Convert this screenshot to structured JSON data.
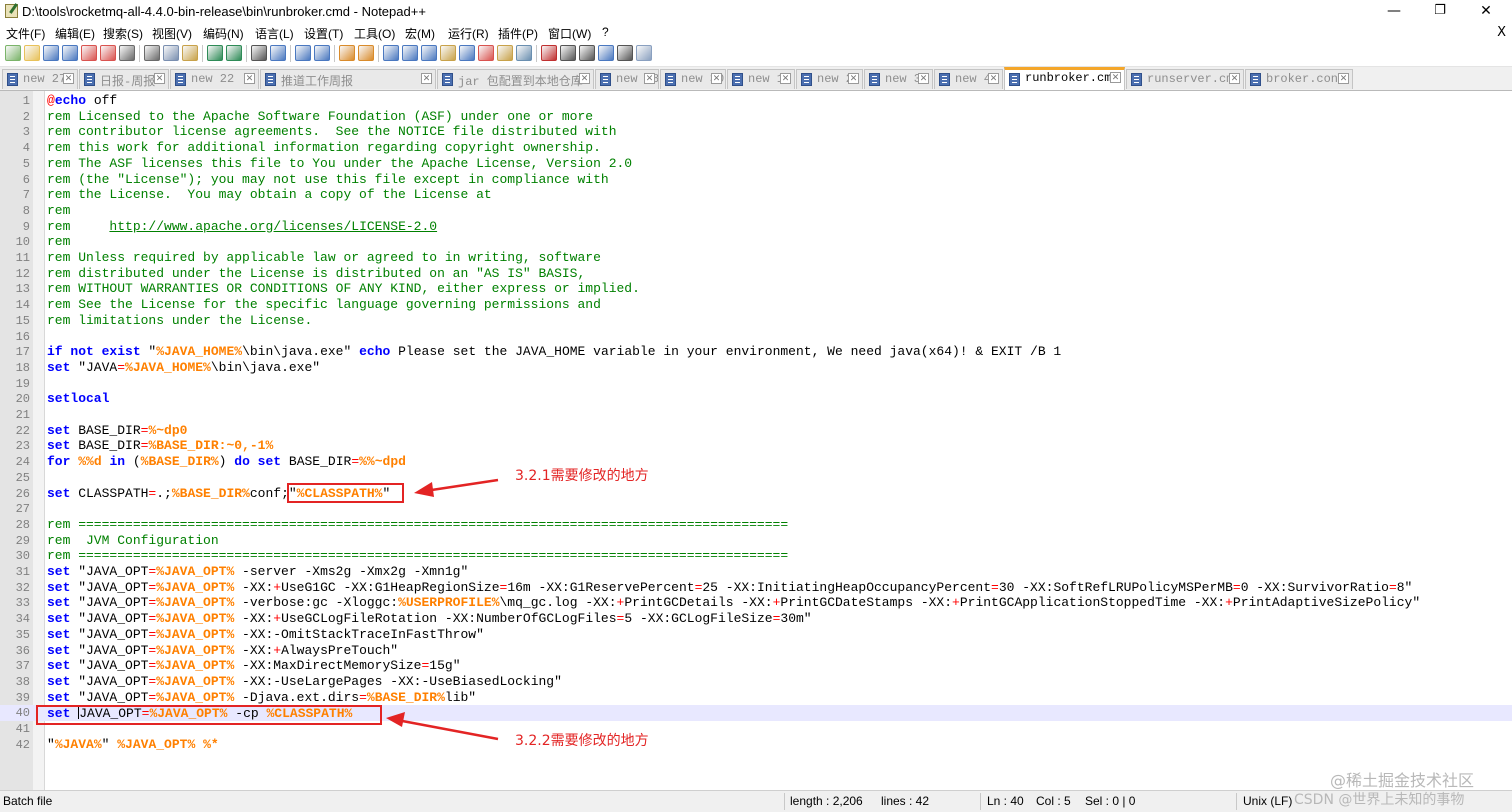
{
  "window": {
    "title": "D:\\tools\\rocketmq-all-4.4.0-bin-release\\bin\\runbroker.cmd - Notepad++",
    "minimize": "—",
    "maximize": "❐",
    "close": "✕"
  },
  "menu": {
    "items": [
      "文件(F)",
      "编辑(E)",
      "搜索(S)",
      "视图(V)",
      "编码(N)",
      "语言(L)",
      "设置(T)",
      "工具(O)",
      "宏(M)",
      "运行(R)",
      "插件(P)",
      "窗口(W)",
      "?"
    ],
    "close": "X"
  },
  "toolbar": {
    "buttons": [
      "new-file",
      "open-file",
      "save",
      "save-all",
      "close",
      "close-all",
      "print",
      "cut",
      "copy",
      "paste",
      "undo",
      "redo",
      "find",
      "replace",
      "zoom-in",
      "zoom-out",
      "sync-vertical",
      "sync-horizontal",
      "word-wrap",
      "show-all-chars",
      "indent-guide",
      "user-defined-language",
      "document-map",
      "function-list",
      "folder-as-workspace",
      "monitoring",
      "record-macro",
      "stop-recording",
      "play-macro",
      "run-macro-multiple",
      "save-macro",
      "trim"
    ]
  },
  "tabs": [
    {
      "label": "new 27",
      "active": false
    },
    {
      "label": "日报-周报",
      "active": false
    },
    {
      "label": "new 22",
      "active": false
    },
    {
      "label": "推道工作周报",
      "active": false
    },
    {
      "label": "jar 包配置到本地仓库",
      "active": false
    },
    {
      "label": "new 28",
      "active": false
    },
    {
      "label": "new 30",
      "active": false
    },
    {
      "label": "new 1",
      "active": false
    },
    {
      "label": "new 2",
      "active": false
    },
    {
      "label": "new 3",
      "active": false
    },
    {
      "label": "new 4",
      "active": false
    },
    {
      "label": "runbroker.cmd",
      "active": true
    },
    {
      "label": "runserver.cmd",
      "active": false
    },
    {
      "label": "broker.conf",
      "active": false
    }
  ],
  "editor": {
    "current_line": 40,
    "lines": [
      [
        [
          "at",
          "@"
        ],
        [
          "kw",
          "echo"
        ],
        [
          "n",
          " off"
        ]
      ],
      [
        [
          "cm",
          "rem Licensed to the Apache Software Foundation (ASF) under one or more"
        ]
      ],
      [
        [
          "cm",
          "rem contributor license agreements.  See the NOTICE file distributed with"
        ]
      ],
      [
        [
          "cm",
          "rem this work for additional information regarding copyright ownership."
        ]
      ],
      [
        [
          "cm",
          "rem The ASF licenses this file to You under the Apache License, Version 2.0"
        ]
      ],
      [
        [
          "cm",
          "rem (the \"License\"); you may not use this file except in compliance with"
        ]
      ],
      [
        [
          "cm",
          "rem the License.  You may obtain a copy of the License at"
        ]
      ],
      [
        [
          "cm",
          "rem"
        ]
      ],
      [
        [
          "cm",
          "rem     "
        ],
        [
          "url",
          "http://www.apache.org/licenses/LICENSE-2.0"
        ]
      ],
      [
        [
          "cm",
          "rem"
        ]
      ],
      [
        [
          "cm",
          "rem Unless required by applicable law or agreed to in writing, software"
        ]
      ],
      [
        [
          "cm",
          "rem distributed under the License is distributed on an \"AS IS\" BASIS,"
        ]
      ],
      [
        [
          "cm",
          "rem WITHOUT WARRANTIES OR CONDITIONS OF ANY KIND, either express or implied."
        ]
      ],
      [
        [
          "cm",
          "rem See the License for the specific language governing permissions and"
        ]
      ],
      [
        [
          "cm",
          "rem limitations under the License."
        ]
      ],
      [],
      [
        [
          "kw",
          "if not exist"
        ],
        [
          "n",
          " \""
        ],
        [
          "var",
          "%JAVA_HOME%"
        ],
        [
          "n",
          "\\bin\\java.exe\" "
        ],
        [
          "kw",
          "echo"
        ],
        [
          "n",
          " Please set the JAVA_HOME variable in your environment, We need java(x64)! & EXIT /B 1"
        ]
      ],
      [
        [
          "kw",
          "set"
        ],
        [
          "n",
          " \"JAVA"
        ],
        [
          "op",
          "="
        ],
        [
          "var",
          "%JAVA_HOME%"
        ],
        [
          "n",
          "\\bin\\java.exe\""
        ]
      ],
      [],
      [
        [
          "kw",
          "setlocal"
        ]
      ],
      [],
      [
        [
          "kw",
          "set"
        ],
        [
          "n",
          " BASE_DIR"
        ],
        [
          "op",
          "="
        ],
        [
          "var",
          "%~dp0"
        ]
      ],
      [
        [
          "kw",
          "set"
        ],
        [
          "n",
          " BASE_DIR"
        ],
        [
          "op",
          "="
        ],
        [
          "var",
          "%BASE_DIR:~0,-1%"
        ]
      ],
      [
        [
          "kw",
          "for"
        ],
        [
          "n",
          " "
        ],
        [
          "var",
          "%%d"
        ],
        [
          "n",
          " "
        ],
        [
          "kw",
          "in"
        ],
        [
          "n",
          " ("
        ],
        [
          "var",
          "%BASE_DIR%"
        ],
        [
          "n",
          ") "
        ],
        [
          "kw",
          "do set"
        ],
        [
          "n",
          " BASE_DIR"
        ],
        [
          "op",
          "="
        ],
        [
          "var",
          "%%~dpd"
        ]
      ],
      [],
      [
        [
          "kw",
          "set"
        ],
        [
          "n",
          " CLASSPATH"
        ],
        [
          "op",
          "="
        ],
        [
          "n",
          ".;"
        ],
        [
          "var",
          "%BASE_DIR%"
        ],
        [
          "n",
          "conf;\""
        ],
        [
          "var",
          "%CLASSPATH%"
        ],
        [
          "n",
          "\""
        ]
      ],
      [],
      [
        [
          "cm",
          "rem ==========================================================================================="
        ]
      ],
      [
        [
          "cm",
          "rem  JVM Configuration"
        ]
      ],
      [
        [
          "cm",
          "rem ==========================================================================================="
        ]
      ],
      [
        [
          "kw",
          "set"
        ],
        [
          "n",
          " \"JAVA_OPT"
        ],
        [
          "op",
          "="
        ],
        [
          "var",
          "%JAVA_OPT%"
        ],
        [
          "n",
          " -server -Xms2g -Xmx2g -Xmn1g\""
        ]
      ],
      [
        [
          "kw",
          "set"
        ],
        [
          "n",
          " \"JAVA_OPT"
        ],
        [
          "op",
          "="
        ],
        [
          "var",
          "%JAVA_OPT%"
        ],
        [
          "n",
          " -XX:"
        ],
        [
          "op",
          "+"
        ],
        [
          "n",
          "UseG1GC -XX:G1HeapRegionSize"
        ],
        [
          "op",
          "="
        ],
        [
          "n",
          "16m -XX:G1ReservePercent"
        ],
        [
          "op",
          "="
        ],
        [
          "n",
          "25 -XX:InitiatingHeapOccupancyPercent"
        ],
        [
          "op",
          "="
        ],
        [
          "n",
          "30 -XX:SoftRefLRUPolicyMSPerMB"
        ],
        [
          "op",
          "="
        ],
        [
          "n",
          "0 -XX:SurvivorRatio"
        ],
        [
          "op",
          "="
        ],
        [
          "n",
          "8\""
        ]
      ],
      [
        [
          "kw",
          "set"
        ],
        [
          "n",
          " \"JAVA_OPT"
        ],
        [
          "op",
          "="
        ],
        [
          "var",
          "%JAVA_OPT%"
        ],
        [
          "n",
          " -verbose:gc -Xloggc:"
        ],
        [
          "var",
          "%USERPROFILE%"
        ],
        [
          "n",
          "\\mq_gc.log -XX:"
        ],
        [
          "op",
          "+"
        ],
        [
          "n",
          "PrintGCDetails -XX:"
        ],
        [
          "op",
          "+"
        ],
        [
          "n",
          "PrintGCDateStamps -XX:"
        ],
        [
          "op",
          "+"
        ],
        [
          "n",
          "PrintGCApplicationStoppedTime -XX:"
        ],
        [
          "op",
          "+"
        ],
        [
          "n",
          "PrintAdaptiveSizePolicy\""
        ]
      ],
      [
        [
          "kw",
          "set"
        ],
        [
          "n",
          " \"JAVA_OPT"
        ],
        [
          "op",
          "="
        ],
        [
          "var",
          "%JAVA_OPT%"
        ],
        [
          "n",
          " -XX:"
        ],
        [
          "op",
          "+"
        ],
        [
          "n",
          "UseGCLogFileRotation -XX:NumberOfGCLogFiles"
        ],
        [
          "op",
          "="
        ],
        [
          "n",
          "5 -XX:GCLogFileSize"
        ],
        [
          "op",
          "="
        ],
        [
          "n",
          "30m\""
        ]
      ],
      [
        [
          "kw",
          "set"
        ],
        [
          "n",
          " \"JAVA_OPT"
        ],
        [
          "op",
          "="
        ],
        [
          "var",
          "%JAVA_OPT%"
        ],
        [
          "n",
          " -XX:-OmitStackTraceInFastThrow\""
        ]
      ],
      [
        [
          "kw",
          "set"
        ],
        [
          "n",
          " \"JAVA_OPT"
        ],
        [
          "op",
          "="
        ],
        [
          "var",
          "%JAVA_OPT%"
        ],
        [
          "n",
          " -XX:"
        ],
        [
          "op",
          "+"
        ],
        [
          "n",
          "AlwaysPreTouch\""
        ]
      ],
      [
        [
          "kw",
          "set"
        ],
        [
          "n",
          " \"JAVA_OPT"
        ],
        [
          "op",
          "="
        ],
        [
          "var",
          "%JAVA_OPT%"
        ],
        [
          "n",
          " -XX:MaxDirectMemorySize"
        ],
        [
          "op",
          "="
        ],
        [
          "n",
          "15g\""
        ]
      ],
      [
        [
          "kw",
          "set"
        ],
        [
          "n",
          " \"JAVA_OPT"
        ],
        [
          "op",
          "="
        ],
        [
          "var",
          "%JAVA_OPT%"
        ],
        [
          "n",
          " -XX:-UseLargePages -XX:-UseBiasedLocking\""
        ]
      ],
      [
        [
          "kw",
          "set"
        ],
        [
          "n",
          " \"JAVA_OPT"
        ],
        [
          "op",
          "="
        ],
        [
          "var",
          "%JAVA_OPT%"
        ],
        [
          "n",
          " -Djava.ext.dirs"
        ],
        [
          "op",
          "="
        ],
        [
          "var",
          "%BASE_DIR%"
        ],
        [
          "n",
          "lib\""
        ]
      ],
      [
        [
          "kw",
          "set"
        ],
        [
          "n",
          " "
        ],
        [
          "cursor",
          ""
        ],
        [
          "n",
          "JAVA_OPT"
        ],
        [
          "op",
          "="
        ],
        [
          "var",
          "%JAVA_OPT%"
        ],
        [
          "n",
          " -cp "
        ],
        [
          "var",
          "%CLASSPATH%"
        ]
      ],
      [],
      [
        [
          "n",
          "\""
        ],
        [
          "var",
          "%JAVA%"
        ],
        [
          "n",
          "\" "
        ],
        [
          "var",
          "%JAVA_OPT%"
        ],
        [
          "n",
          " "
        ],
        [
          "var",
          "%*"
        ]
      ]
    ]
  },
  "annotations": [
    {
      "label": "3.2.1需要修改的地方"
    },
    {
      "label": "3.2.2需要修改的地方"
    }
  ],
  "watermarks": [
    "@稀土掘金技术社区",
    "CSDN @世界上未知的事物"
  ],
  "status": {
    "file_type": "Batch file",
    "length": "length : 2,206",
    "lines": "lines : 42",
    "ln": "Ln : 40",
    "col": "Col : 5",
    "sel": "Sel : 0 | 0",
    "eol": "Unix (LF)"
  },
  "colors": {
    "accent_tab": "#f4a62a",
    "annotation": "#e32424",
    "comment": "#008000",
    "keyword": "#0000ff",
    "variable": "#ff8000"
  }
}
